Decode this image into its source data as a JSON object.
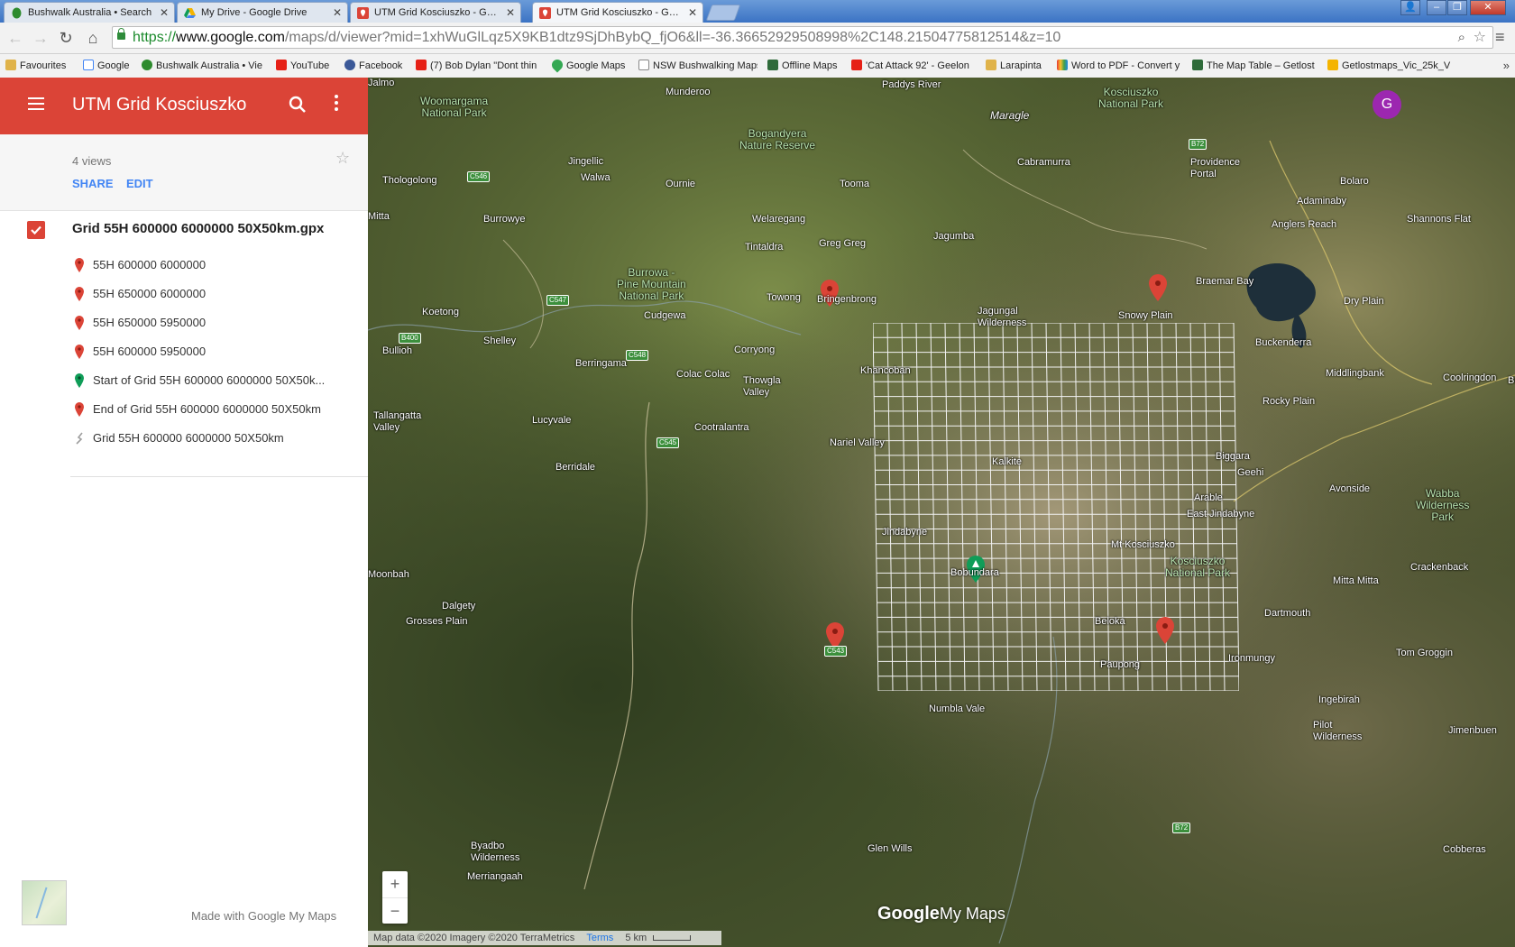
{
  "browser": {
    "tabs": [
      {
        "title": "Bushwalk Australia • Search",
        "icon": "bushwalk-leaf-icon",
        "active": false
      },
      {
        "title": "My Drive - Google Drive",
        "icon": "google-drive-icon",
        "active": false
      },
      {
        "title": "UTM Grid Kosciuszko - Google",
        "icon": "google-mymaps-icon",
        "active": false
      },
      {
        "title": "UTM Grid Kosciuszko - Google",
        "icon": "google-mymaps-icon",
        "active": true
      }
    ],
    "url": {
      "scheme": "https://",
      "host": "www.google.com",
      "path": "/maps/d/viewer?mid=1xhWuGlLqz5X9KB1dtz9SjDhBybQ_fjO6&ll=-36.36652929508998%2C148.21504775812514&z=10"
    },
    "bookmarks": [
      {
        "label": "Favourites",
        "icon": "folder-icon",
        "color": "#e0b34a"
      },
      {
        "label": "Google",
        "icon": "google-icon",
        "color": "#4285f4"
      },
      {
        "label": "Bushwalk Australia • Vie",
        "icon": "bushwalk-leaf-icon",
        "color": "#2e8b2e"
      },
      {
        "label": "YouTube",
        "icon": "youtube-icon",
        "color": "#e62117"
      },
      {
        "label": "Facebook",
        "icon": "facebook-icon",
        "color": "#3b5998"
      },
      {
        "label": "(7) Bob Dylan \"Dont thin",
        "icon": "youtube-icon",
        "color": "#e62117"
      },
      {
        "label": "Google Maps",
        "icon": "google-maps-icon",
        "color": "#34a853"
      },
      {
        "label": "NSW Bushwalking Maps",
        "icon": "page-icon",
        "color": "#ffffff"
      },
      {
        "label": "Offline Maps",
        "icon": "offline-maps-icon",
        "color": "#2f6b3a"
      },
      {
        "label": "'Cat Attack 92' - Geelon",
        "icon": "youtube-icon",
        "color": "#e62117"
      },
      {
        "label": "Larapinta",
        "icon": "folder-icon",
        "color": "#e0b34a"
      },
      {
        "label": "Word to PDF - Convert y",
        "icon": "word-pdf-icon",
        "color": "#7b3fbf"
      },
      {
        "label": "The Map Table – Getlost",
        "icon": "maptable-icon",
        "color": "#2f6b3a"
      },
      {
        "label": "Getlostmaps_Vic_25k_V",
        "icon": "google-drive-icon",
        "color": "#f4b400"
      }
    ],
    "bookmarks_more": "»"
  },
  "sidebar": {
    "title": "UTM Grid Kosciuszko",
    "views": "4 views",
    "share_label": "SHARE",
    "edit_label": "EDIT",
    "layer_name": "Grid 55H 600000 6000000 50X50km.gpx",
    "features": [
      {
        "label": "55H 600000 6000000",
        "icon": "red-pin-icon",
        "color": "#db4437"
      },
      {
        "label": "55H 650000 6000000",
        "icon": "red-pin-icon",
        "color": "#db4437"
      },
      {
        "label": "55H 650000 5950000",
        "icon": "red-pin-icon",
        "color": "#db4437"
      },
      {
        "label": "55H 600000 5950000",
        "icon": "red-pin-icon",
        "color": "#db4437"
      },
      {
        "label": "Start of Grid 55H 600000 6000000 50X50k...",
        "icon": "green-pin-icon",
        "color": "#0f9d58"
      },
      {
        "label": "End of Grid 55H 600000 6000000 50X50km",
        "icon": "red-pin-icon",
        "color": "#db4437"
      },
      {
        "label": "Grid 55H 600000 6000000 50X50km",
        "icon": "line-path-icon",
        "color": "#9e9e9e"
      }
    ],
    "made_with": "Made with Google My Maps"
  },
  "map": {
    "avatar_letter": "G",
    "zoom_in": "+",
    "zoom_out": "−",
    "attribution": "Map data ©2020 Imagery ©2020 TerraMetrics",
    "terms": "Terms",
    "scale": "5 km",
    "logo_google": "Google",
    "logo_mymaps": "My Maps",
    "places": [
      {
        "name": "Munderoo",
        "kind": "town"
      },
      {
        "name": "Paddys River",
        "kind": "town"
      },
      {
        "name": "Kosciuszko\nNational Park",
        "kind": "park"
      },
      {
        "name": "Woomargama\nNational Park",
        "kind": "park"
      },
      {
        "name": "Maragle",
        "kind": "big"
      },
      {
        "name": "Bogandyera\nNature Reserve",
        "kind": "park"
      },
      {
        "name": "B72",
        "kind": "road"
      },
      {
        "name": "Providence\nPortal",
        "kind": "town"
      },
      {
        "name": "Cabramurra",
        "kind": "town"
      },
      {
        "name": "Jingellic",
        "kind": "town"
      },
      {
        "name": "C546",
        "kind": "road"
      },
      {
        "name": "Thologolong",
        "kind": "town"
      },
      {
        "name": "Walwa",
        "kind": "town"
      },
      {
        "name": "Ournie",
        "kind": "town"
      },
      {
        "name": "Tooma",
        "kind": "town"
      },
      {
        "name": "Bolaro",
        "kind": "town"
      },
      {
        "name": "Adaminaby",
        "kind": "town"
      },
      {
        "name": "Burrowye",
        "kind": "town"
      },
      {
        "name": "Welaregang",
        "kind": "town"
      },
      {
        "name": "Anglers Reach",
        "kind": "town"
      },
      {
        "name": "Shannons Flat",
        "kind": "town"
      },
      {
        "name": "Jagumba",
        "kind": "town"
      },
      {
        "name": "Greg Greg",
        "kind": "town"
      },
      {
        "name": "Tintaldra",
        "kind": "town"
      },
      {
        "name": "Burrowa -\nPine Mountain\nNational Park",
        "kind": "park"
      },
      {
        "name": "C547",
        "kind": "road"
      },
      {
        "name": "Towong",
        "kind": "town"
      },
      {
        "name": "Bringenbrong",
        "kind": "town"
      },
      {
        "name": "Braemar Bay",
        "kind": "town"
      },
      {
        "name": "Dry Plain",
        "kind": "town"
      },
      {
        "name": "Koetong",
        "kind": "town"
      },
      {
        "name": "Cudgewa",
        "kind": "town"
      },
      {
        "name": "Jagungal\nWilderness",
        "kind": "town"
      },
      {
        "name": "Snowy Plain",
        "kind": "town"
      },
      {
        "name": "B400",
        "kind": "road"
      },
      {
        "name": "Bullioh",
        "kind": "town"
      },
      {
        "name": "Shelley",
        "kind": "town"
      },
      {
        "name": "Corryong",
        "kind": "town"
      },
      {
        "name": "Buckenderra",
        "kind": "town"
      },
      {
        "name": "C548",
        "kind": "road"
      },
      {
        "name": "Berringama",
        "kind": "town"
      },
      {
        "name": "Colac Colac",
        "kind": "town"
      },
      {
        "name": "Thowgla\nValley",
        "kind": "town"
      },
      {
        "name": "Khancoban",
        "kind": "town"
      },
      {
        "name": "Middlingbank",
        "kind": "town"
      },
      {
        "name": "Coolringdon",
        "kind": "town"
      },
      {
        "name": "Rocky Plain",
        "kind": "town"
      },
      {
        "name": "Tallangatta\nValley",
        "kind": "town"
      },
      {
        "name": "Lucyvale",
        "kind": "town"
      },
      {
        "name": "Cootralantra",
        "kind": "town"
      },
      {
        "name": "C545",
        "kind": "road"
      },
      {
        "name": "Nariel Valley",
        "kind": "town"
      },
      {
        "name": "Biggara",
        "kind": "town"
      },
      {
        "name": "Kalkite",
        "kind": "town"
      },
      {
        "name": "Geehi",
        "kind": "town"
      },
      {
        "name": "Avonside",
        "kind": "town"
      },
      {
        "name": "Berridale",
        "kind": "town"
      },
      {
        "name": "Wabba\nWilderness\nPark",
        "kind": "park"
      },
      {
        "name": "Arable",
        "kind": "town"
      },
      {
        "name": "East Jindabyne",
        "kind": "town"
      },
      {
        "name": "Jindabyne",
        "kind": "town"
      },
      {
        "name": "Mt Kosciuszko",
        "kind": "town"
      },
      {
        "name": "Crackenback",
        "kind": "town"
      },
      {
        "name": "Bobundara",
        "kind": "town"
      },
      {
        "name": "Kosciuszko\nNational Park",
        "kind": "park"
      },
      {
        "name": "Moonbah",
        "kind": "town"
      },
      {
        "name": "Mitta Mitta",
        "kind": "town"
      },
      {
        "name": "Dalgety",
        "kind": "town"
      },
      {
        "name": "Dartmouth",
        "kind": "town"
      },
      {
        "name": "Beloka",
        "kind": "town"
      },
      {
        "name": "Grosses Plain",
        "kind": "town"
      },
      {
        "name": "C543",
        "kind": "road"
      },
      {
        "name": "Tom Groggin",
        "kind": "town"
      },
      {
        "name": "Ironmungy",
        "kind": "town"
      },
      {
        "name": "Paupong",
        "kind": "town"
      },
      {
        "name": "Ingebirah",
        "kind": "town"
      },
      {
        "name": "Numbla Vale",
        "kind": "town"
      },
      {
        "name": "Pilot\nWilderness",
        "kind": "town"
      },
      {
        "name": "Jimenbuen",
        "kind": "town"
      },
      {
        "name": "Bungarby",
        "kind": "town"
      },
      {
        "name": "B72",
        "kind": "road"
      },
      {
        "name": "Byadbo\nWilderness",
        "kind": "town"
      },
      {
        "name": "Glen Wills",
        "kind": "town"
      },
      {
        "name": "Cobberas",
        "kind": "town"
      },
      {
        "name": "Merriangaah",
        "kind": "town"
      },
      {
        "name": "Mitta",
        "kind": "town"
      },
      {
        "name": "Jalmo",
        "kind": "town"
      }
    ]
  },
  "colors": {
    "mymaps_red": "#db4437",
    "link_blue": "#4285f4",
    "avatar_purple": "#9c27b0"
  }
}
